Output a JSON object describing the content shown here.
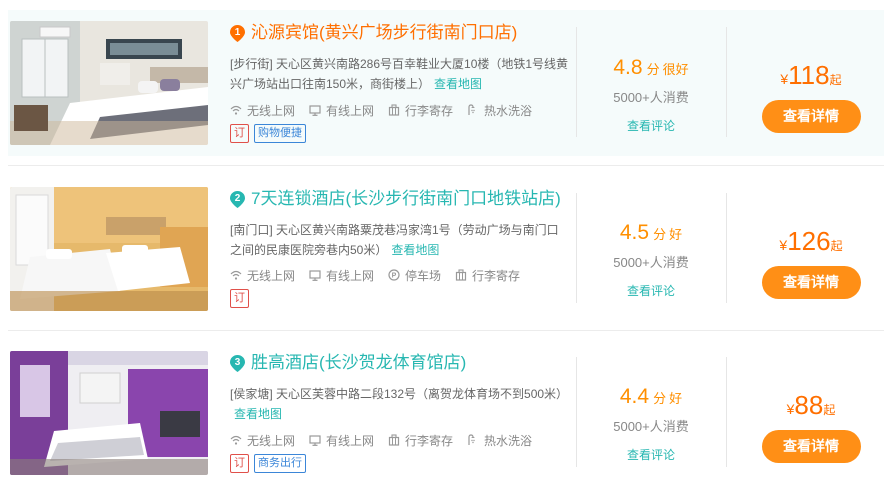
{
  "hotels": [
    {
      "rank": "1",
      "name": "沁源宾馆(黄兴广场步行街南门口店)",
      "address": "[步行街] 天心区黄兴南路286号百幸鞋业大厦10楼（地铁1号线黄兴广场站出口往南150米，商街楼上）",
      "map_link": "查看地图",
      "amenities": [
        {
          "icon": "wifi-icon",
          "label": "无线上网"
        },
        {
          "icon": "monitor-icon",
          "label": "有线上网"
        },
        {
          "icon": "luggage-icon",
          "label": "行李寄存"
        },
        {
          "icon": "shower-icon",
          "label": "热水洗浴"
        }
      ],
      "tags": [
        {
          "label": "订",
          "style": "red"
        },
        {
          "label": "购物便捷",
          "style": "blue"
        }
      ],
      "score": "4.8",
      "score_unit": "分",
      "score_word": "很好",
      "consumers": "5000+人消费",
      "review_link": "查看评论",
      "currency": "¥",
      "price": "118",
      "price_suffix": "起",
      "detail_button": "查看详情"
    },
    {
      "rank": "2",
      "name": "7天连锁酒店(长沙步行街南门口地铁站店)",
      "address": "[南门口] 天心区黄兴南路粟茂巷冯家湾1号（劳动广场与南门口之间的民康医院旁巷内50米）",
      "map_link": "查看地图",
      "amenities": [
        {
          "icon": "wifi-icon",
          "label": "无线上网"
        },
        {
          "icon": "monitor-icon",
          "label": "有线上网"
        },
        {
          "icon": "parking-icon",
          "label": "停车场"
        },
        {
          "icon": "luggage-icon",
          "label": "行李寄存"
        }
      ],
      "tags": [
        {
          "label": "订",
          "style": "red"
        }
      ],
      "score": "4.5",
      "score_unit": "分",
      "score_word": "好",
      "consumers": "5000+人消费",
      "review_link": "查看评论",
      "currency": "¥",
      "price": "126",
      "price_suffix": "起",
      "detail_button": "查看详情"
    },
    {
      "rank": "3",
      "name": "胜高酒店(长沙贺龙体育馆店)",
      "address": "[侯家塘] 天心区芙蓉中路二段132号（离贺龙体育场不到500米）",
      "map_link": "查看地图",
      "amenities": [
        {
          "icon": "wifi-icon",
          "label": "无线上网"
        },
        {
          "icon": "monitor-icon",
          "label": "有线上网"
        },
        {
          "icon": "luggage-icon",
          "label": "行李寄存"
        },
        {
          "icon": "shower-icon",
          "label": "热水洗浴"
        }
      ],
      "tags": [
        {
          "label": "订",
          "style": "red"
        },
        {
          "label": "商务出行",
          "style": "blue"
        }
      ],
      "score": "4.4",
      "score_unit": "分",
      "score_word": "好",
      "consumers": "5000+人消费",
      "review_link": "查看评论",
      "currency": "¥",
      "price": "88",
      "price_suffix": "起",
      "detail_button": "查看详情"
    }
  ],
  "colors": {
    "first_title": "#ff6f00",
    "title": "#27b7b1",
    "score": "#ff8f00",
    "price": "#ff6f00",
    "button": "#ff8f16",
    "highlight_row": "#f5fbfb"
  }
}
